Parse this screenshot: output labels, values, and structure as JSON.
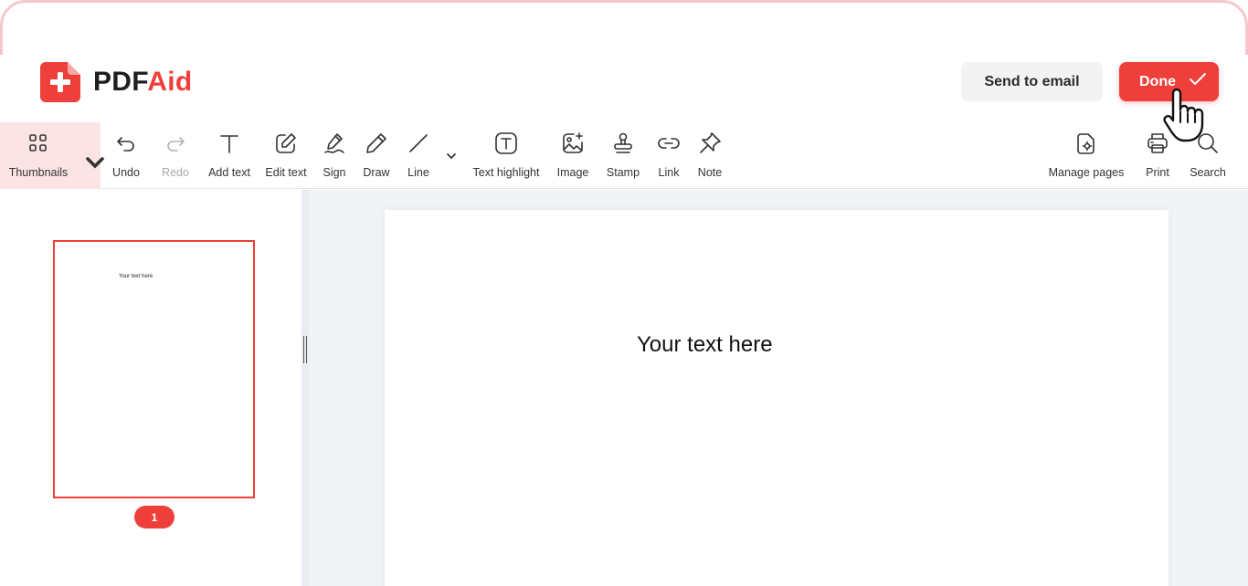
{
  "brand": {
    "name_part1": "PDF",
    "name_part2": "Aid",
    "accent_color": "#ee3f3a"
  },
  "header": {
    "send_email_label": "Send to email",
    "done_label": "Done"
  },
  "toolbar": {
    "thumbnails": "Thumbnails",
    "undo": "Undo",
    "redo": "Redo",
    "add_text": "Add text",
    "edit_text": "Edit text",
    "sign": "Sign",
    "draw": "Draw",
    "line": "Line",
    "text_highlight": "Text highlight",
    "image": "Image",
    "stamp": "Stamp",
    "link": "Link",
    "note": "Note",
    "manage_pages": "Manage pages",
    "print": "Print",
    "search": "Search"
  },
  "sidebar": {
    "thumb_text": "Your text here",
    "page_number": "1"
  },
  "document": {
    "text": "Your text here"
  },
  "icons": [
    "plus-logo-icon",
    "thumbnails-grid-icon",
    "chevron-down-icon",
    "undo-icon",
    "redo-icon",
    "text-icon",
    "edit-icon",
    "sign-pen-icon",
    "pencil-icon",
    "line-icon",
    "text-highlight-icon",
    "image-icon",
    "stamp-icon",
    "link-icon",
    "pin-icon",
    "manage-pages-icon",
    "printer-icon",
    "search-icon",
    "checkmark-icon",
    "hand-cursor-icon"
  ]
}
